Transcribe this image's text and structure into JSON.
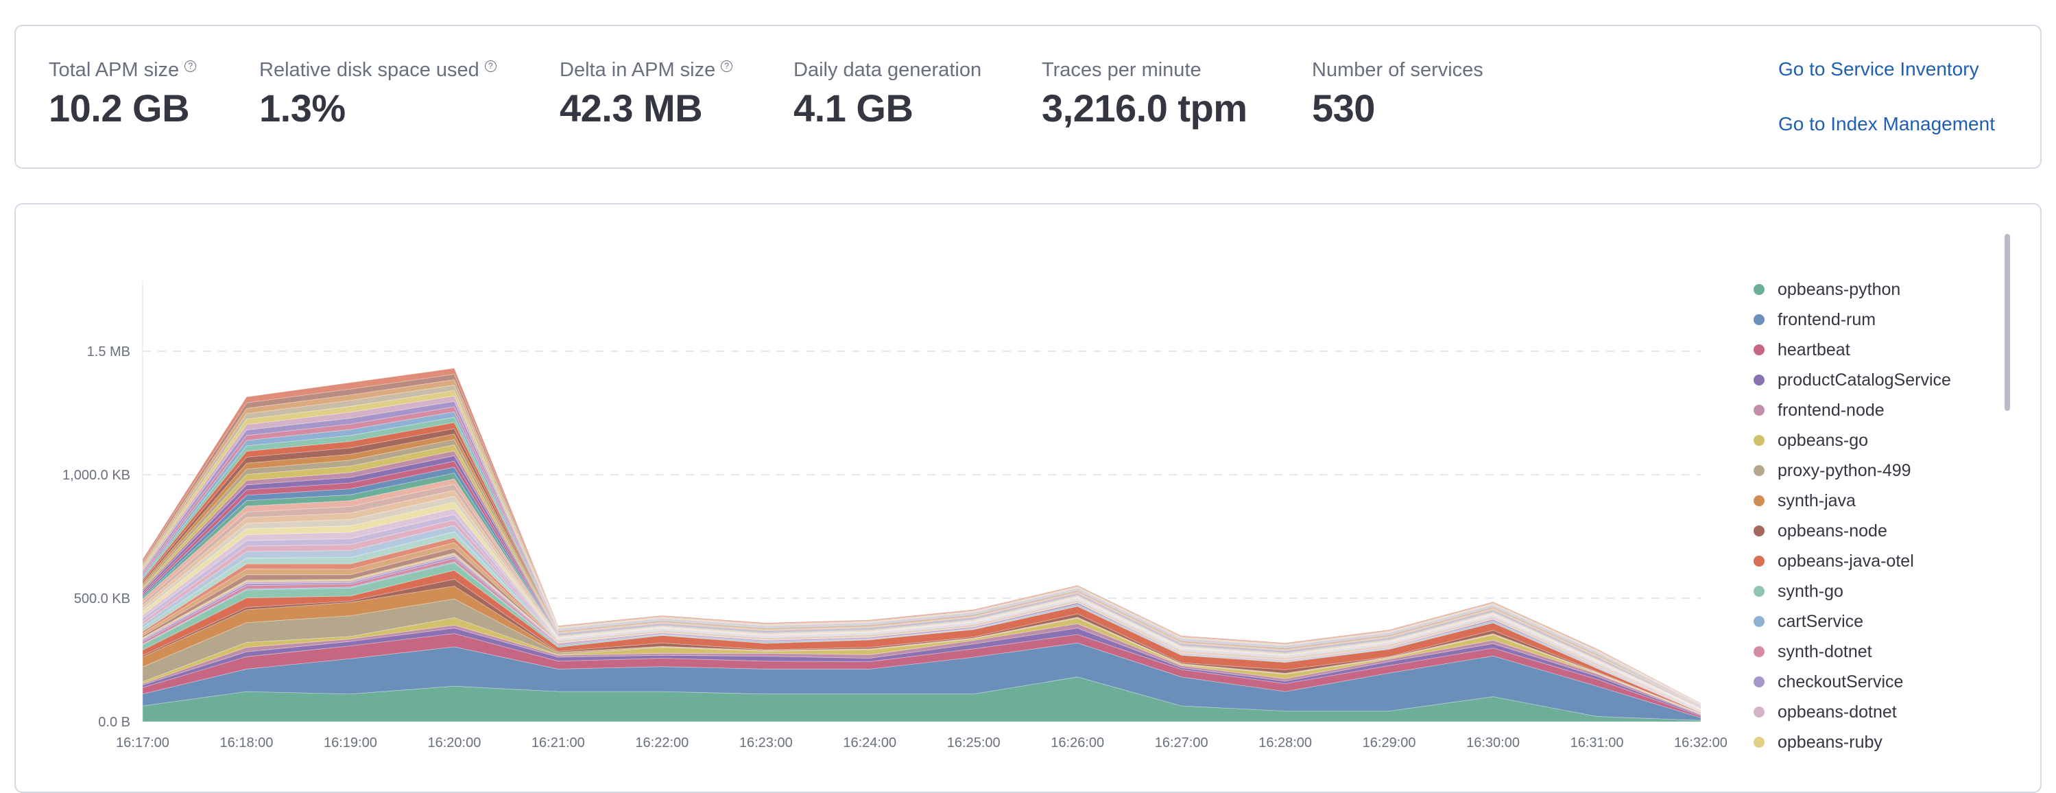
{
  "stats": {
    "items": [
      {
        "label": "Total APM size",
        "value": "10.2 GB",
        "has_help": true
      },
      {
        "label": "Relative disk space used",
        "value": "1.3%",
        "has_help": true
      },
      {
        "label": "Delta in APM size",
        "value": "42.3 MB",
        "has_help": true
      },
      {
        "label": "Daily data generation",
        "value": "4.1 GB",
        "has_help": false
      },
      {
        "label": "Traces per minute",
        "value": "3,216.0 tpm",
        "has_help": false
      },
      {
        "label": "Number of services",
        "value": "530",
        "has_help": false
      }
    ],
    "help_icon": "question-circle-icon",
    "links": {
      "service_inventory": "Go to Service Inventory",
      "index_management": "Go to Index Management"
    }
  },
  "chart_data": {
    "type": "area",
    "stacked": true,
    "title": "",
    "xlabel": "",
    "ylabel": "",
    "x": [
      "16:17:00",
      "16:18:00",
      "16:19:00",
      "16:20:00",
      "16:21:00",
      "16:22:00",
      "16:23:00",
      "16:24:00",
      "16:25:00",
      "16:26:00",
      "16:27:00",
      "16:28:00",
      "16:29:00",
      "16:30:00",
      "16:31:00",
      "16:32:00"
    ],
    "y_unit": "KB",
    "ylim": [
      0,
      1820
    ],
    "y_ticks": [
      {
        "value": 0,
        "label": "0.0 B"
      },
      {
        "value": 500,
        "label": "500.0 KB"
      },
      {
        "value": 1000,
        "label": "1,000.0 KB"
      },
      {
        "value": 1500,
        "label": "1.5 MB"
      }
    ],
    "grid": "horizontal-dashed",
    "legend_position": "right",
    "series": [
      {
        "name": "opbeans-python",
        "color": "#6dae98",
        "values": [
          64,
          122,
          112,
          144,
          122,
          122,
          112,
          112,
          112,
          181,
          64,
          43,
          43,
          101,
          21,
          5
        ]
      },
      {
        "name": "frontend-rum",
        "color": "#6a8fbb",
        "values": [
          48,
          91,
          143,
          159,
          91,
          101,
          101,
          101,
          149,
          138,
          117,
          79,
          154,
          165,
          123,
          11
        ]
      },
      {
        "name": "heartbeat",
        "color": "#c76683",
        "values": [
          26,
          50,
          52,
          54,
          32,
          34,
          32,
          30,
          34,
          34,
          30,
          32,
          30,
          32,
          28,
          6
        ]
      },
      {
        "name": "productCatalogService",
        "color": "#8a72b2",
        "values": [
          10,
          20,
          18,
          22,
          16,
          12,
          20,
          14,
          20,
          26,
          8,
          10,
          16,
          18,
          12,
          4
        ]
      },
      {
        "name": "frontend-node",
        "color": "#c08ea8",
        "values": [
          6,
          18,
          10,
          12,
          8,
          8,
          12,
          14,
          14,
          18,
          8,
          10,
          10,
          14,
          10,
          3
        ]
      },
      {
        "name": "opbeans-go",
        "color": "#d3c06a",
        "values": [
          8,
          20,
          10,
          30,
          2,
          24,
          8,
          20,
          6,
          22,
          4,
          18,
          4,
          22,
          2,
          2
        ]
      },
      {
        "name": "proxy-python-499",
        "color": "#b5a78b",
        "values": [
          60,
          80,
          84,
          76,
          6,
          2,
          2,
          2,
          2,
          2,
          2,
          2,
          2,
          2,
          2,
          1
        ]
      },
      {
        "name": "synth-java",
        "color": "#d18e54",
        "values": [
          40,
          52,
          54,
          52,
          4,
          2,
          2,
          2,
          2,
          2,
          2,
          2,
          2,
          2,
          2,
          1
        ]
      },
      {
        "name": "opbeans-node",
        "color": "#a4685c",
        "values": [
          6,
          10,
          6,
          28,
          4,
          14,
          2,
          6,
          4,
          14,
          4,
          14,
          2,
          14,
          2,
          1
        ]
      },
      {
        "name": "opbeans-java-otel",
        "color": "#d96e55",
        "values": [
          22,
          38,
          20,
          36,
          16,
          30,
          26,
          30,
          30,
          30,
          30,
          30,
          30,
          30,
          14,
          2
        ]
      },
      {
        "name": "synth-go",
        "color": "#8fc6b2",
        "values": [
          22,
          32,
          32,
          30,
          4,
          2,
          2,
          2,
          2,
          2,
          2,
          2,
          2,
          2,
          2,
          1
        ]
      },
      {
        "name": "cartService",
        "color": "#8fb1d3",
        "values": [
          2,
          4,
          4,
          4,
          4,
          2,
          4,
          2,
          2,
          4,
          2,
          2,
          2,
          4,
          2,
          1
        ]
      },
      {
        "name": "synth-dotnet",
        "color": "#d58ba2",
        "values": [
          10,
          14,
          12,
          14,
          4,
          2,
          2,
          2,
          2,
          2,
          2,
          2,
          2,
          2,
          2,
          1
        ]
      },
      {
        "name": "checkoutService",
        "color": "#a796c9",
        "values": [
          6,
          8,
          6,
          8,
          4,
          4,
          4,
          4,
          4,
          6,
          2,
          2,
          2,
          6,
          2,
          1
        ]
      },
      {
        "name": "opbeans-dotnet",
        "color": "#d4b2c7",
        "values": [
          6,
          8,
          8,
          8,
          2,
          2,
          2,
          2,
          2,
          2,
          2,
          2,
          2,
          2,
          2,
          1
        ]
      },
      {
        "name": "opbeans-ruby",
        "color": "#e0cf87",
        "values": [
          4,
          6,
          6,
          6,
          2,
          2,
          2,
          2,
          2,
          2,
          2,
          2,
          2,
          2,
          2,
          1
        ]
      }
    ],
    "additional_unlisted_series": [
      {
        "color": "#b88c80",
        "values": [
          8,
          22,
          18,
          20,
          2,
          2,
          2,
          2,
          2,
          2,
          2,
          2,
          2,
          2,
          2,
          1
        ]
      },
      {
        "color": "#dcaa7f",
        "values": [
          10,
          24,
          22,
          22,
          2,
          2,
          2,
          2,
          2,
          2,
          2,
          2,
          2,
          2,
          2,
          1
        ]
      },
      {
        "color": "#e08c78",
        "values": [
          8,
          20,
          22,
          20,
          2,
          2,
          2,
          2,
          2,
          2,
          2,
          2,
          2,
          2,
          2,
          1
        ]
      },
      {
        "color": "#b4d8ce",
        "values": [
          14,
          24,
          26,
          24,
          2,
          2,
          2,
          2,
          2,
          2,
          2,
          2,
          2,
          2,
          2,
          1
        ]
      },
      {
        "color": "#b6c9de",
        "values": [
          14,
          26,
          28,
          26,
          2,
          2,
          2,
          2,
          2,
          2,
          2,
          2,
          2,
          2,
          2,
          1
        ]
      },
      {
        "color": "#e1b1c1",
        "values": [
          12,
          22,
          24,
          22,
          2,
          2,
          2,
          2,
          2,
          2,
          2,
          2,
          2,
          2,
          2,
          1
        ]
      },
      {
        "color": "#c8bcdc",
        "values": [
          14,
          22,
          24,
          22,
          2,
          2,
          2,
          2,
          2,
          2,
          2,
          2,
          2,
          2,
          2,
          1
        ]
      },
      {
        "color": "#dec7d8",
        "values": [
          12,
          24,
          26,
          24,
          2,
          2,
          2,
          2,
          2,
          2,
          2,
          2,
          2,
          2,
          2,
          1
        ]
      },
      {
        "color": "#ece0ad",
        "values": [
          14,
          24,
          26,
          26,
          2,
          2,
          2,
          2,
          2,
          2,
          2,
          2,
          2,
          2,
          2,
          1
        ]
      },
      {
        "color": "#dcd2c4",
        "values": [
          12,
          22,
          26,
          24,
          2,
          2,
          2,
          2,
          2,
          2,
          2,
          2,
          2,
          2,
          2,
          1
        ]
      },
      {
        "color": "#e7c3a5",
        "values": [
          12,
          24,
          26,
          24,
          2,
          2,
          2,
          2,
          2,
          2,
          2,
          2,
          2,
          2,
          2,
          1
        ]
      },
      {
        "color": "#d3b3ab",
        "values": [
          12,
          22,
          26,
          24,
          2,
          2,
          2,
          2,
          2,
          2,
          2,
          2,
          2,
          2,
          2,
          1
        ]
      },
      {
        "color": "#e9b4a6",
        "values": [
          14,
          24,
          24,
          22,
          2,
          2,
          2,
          2,
          2,
          2,
          2,
          2,
          2,
          2,
          2,
          1
        ]
      },
      {
        "color": "#6dae98",
        "values": [
          8,
          22,
          24,
          24,
          2,
          2,
          2,
          2,
          2,
          2,
          2,
          2,
          2,
          2,
          2,
          1
        ]
      },
      {
        "color": "#6a8fbb",
        "values": [
          8,
          22,
          24,
          24,
          2,
          2,
          2,
          2,
          2,
          2,
          2,
          2,
          2,
          2,
          2,
          1
        ]
      },
      {
        "color": "#c76683",
        "values": [
          8,
          22,
          24,
          24,
          2,
          2,
          2,
          2,
          2,
          2,
          2,
          2,
          2,
          2,
          2,
          1
        ]
      },
      {
        "color": "#8a72b2",
        "values": [
          8,
          20,
          22,
          22,
          2,
          2,
          2,
          2,
          2,
          2,
          2,
          2,
          2,
          2,
          2,
          1
        ]
      },
      {
        "color": "#c08ea8",
        "values": [
          8,
          18,
          20,
          20,
          2,
          2,
          2,
          2,
          2,
          2,
          2,
          2,
          2,
          2,
          2,
          1
        ]
      },
      {
        "color": "#d3c06a",
        "values": [
          8,
          24,
          26,
          24,
          2,
          2,
          2,
          2,
          2,
          2,
          2,
          2,
          2,
          2,
          2,
          1
        ]
      },
      {
        "color": "#b5a78b",
        "values": [
          8,
          22,
          24,
          22,
          2,
          2,
          2,
          2,
          2,
          2,
          2,
          2,
          2,
          2,
          2,
          1
        ]
      },
      {
        "color": "#d18e54",
        "values": [
          8,
          24,
          24,
          22,
          2,
          2,
          2,
          2,
          2,
          2,
          2,
          2,
          2,
          2,
          2,
          1
        ]
      },
      {
        "color": "#a4685c",
        "values": [
          8,
          24,
          26,
          22,
          2,
          2,
          2,
          2,
          2,
          2,
          2,
          2,
          2,
          2,
          2,
          1
        ]
      },
      {
        "color": "#d96e55",
        "values": [
          8,
          24,
          26,
          24,
          2,
          2,
          2,
          2,
          2,
          2,
          2,
          2,
          2,
          2,
          2,
          1
        ]
      },
      {
        "color": "#8fc6b2",
        "values": [
          8,
          22,
          24,
          22,
          2,
          2,
          2,
          2,
          2,
          2,
          2,
          2,
          2,
          2,
          2,
          1
        ]
      },
      {
        "color": "#8fb1d3",
        "values": [
          8,
          22,
          24,
          22,
          2,
          2,
          2,
          2,
          2,
          2,
          2,
          2,
          2,
          2,
          2,
          1
        ]
      },
      {
        "color": "#d58ba2",
        "values": [
          8,
          20,
          22,
          20,
          2,
          2,
          2,
          2,
          2,
          2,
          2,
          2,
          2,
          2,
          2,
          1
        ]
      },
      {
        "color": "#a796c9",
        "values": [
          8,
          22,
          24,
          22,
          2,
          2,
          2,
          2,
          2,
          2,
          2,
          2,
          2,
          2,
          2,
          1
        ]
      },
      {
        "color": "#d4b2c7",
        "values": [
          8,
          22,
          24,
          22,
          2,
          2,
          2,
          2,
          2,
          2,
          2,
          2,
          2,
          2,
          2,
          1
        ]
      },
      {
        "color": "#e0cf87",
        "values": [
          8,
          22,
          24,
          22,
          2,
          2,
          2,
          2,
          2,
          2,
          2,
          2,
          2,
          2,
          2,
          1
        ]
      },
      {
        "color": "#c9bda8",
        "values": [
          8,
          22,
          24,
          22,
          2,
          2,
          2,
          2,
          2,
          2,
          2,
          2,
          2,
          2,
          2,
          1
        ]
      },
      {
        "color": "#dcaa7f",
        "values": [
          8,
          22,
          22,
          22,
          2,
          2,
          2,
          2,
          2,
          2,
          2,
          2,
          2,
          2,
          2,
          1
        ]
      },
      {
        "color": "#b88c80",
        "values": [
          8,
          22,
          24,
          22,
          2,
          2,
          2,
          2,
          2,
          2,
          2,
          2,
          2,
          2,
          2,
          1
        ]
      },
      {
        "color": "#e08c78",
        "values": [
          10,
          24,
          26,
          24,
          3,
          3,
          3,
          3,
          3,
          3,
          3,
          3,
          3,
          3,
          3,
          1
        ]
      }
    ]
  }
}
